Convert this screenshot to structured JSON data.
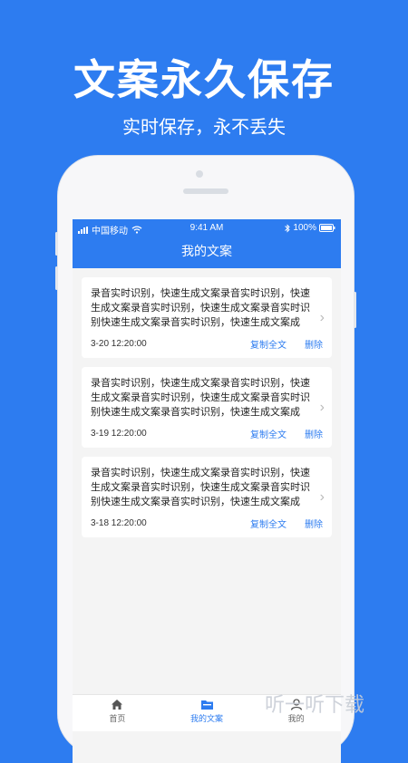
{
  "promo": {
    "headline": "文案永久保存",
    "subline": "实时保存，永不丢失"
  },
  "status_bar": {
    "carrier": "中国移动",
    "time": "9:41 AM",
    "battery": "100%"
  },
  "nav": {
    "title": "我的文案"
  },
  "cards": [
    {
      "text": "录音实时识别，快速生成文案录音实时识别，快速生成文案录音实时识别，快速生成文案录音实时识别快速生成文案录音实时识别，快速生成文案成",
      "date": "3-20 12:20:00",
      "copy_label": "复制全文",
      "delete_label": "删除"
    },
    {
      "text": "录音实时识别，快速生成文案录音实时识别，快速生成文案录音实时识别，快速生成文案录音实时识别快速生成文案录音实时识别，快速生成文案成",
      "date": "3-19 12:20:00",
      "copy_label": "复制全文",
      "delete_label": "删除"
    },
    {
      "text": "录音实时识别，快速生成文案录音实时识别，快速生成文案录音实时识别，快速生成文案录音实时识别快速生成文案录音实时识别，快速生成文案成",
      "date": "3-18 12:20:00",
      "copy_label": "复制全文",
      "delete_label": "删除"
    }
  ],
  "tabs": [
    {
      "label": "首页",
      "icon": "home-icon",
      "active": false
    },
    {
      "label": "我的文案",
      "icon": "folder-icon",
      "active": true
    },
    {
      "label": "我的",
      "icon": "user-icon",
      "active": false
    }
  ],
  "watermark": "听一听下载",
  "colors": {
    "brand": "#2d7cf0",
    "background": "#f4f4f4"
  }
}
